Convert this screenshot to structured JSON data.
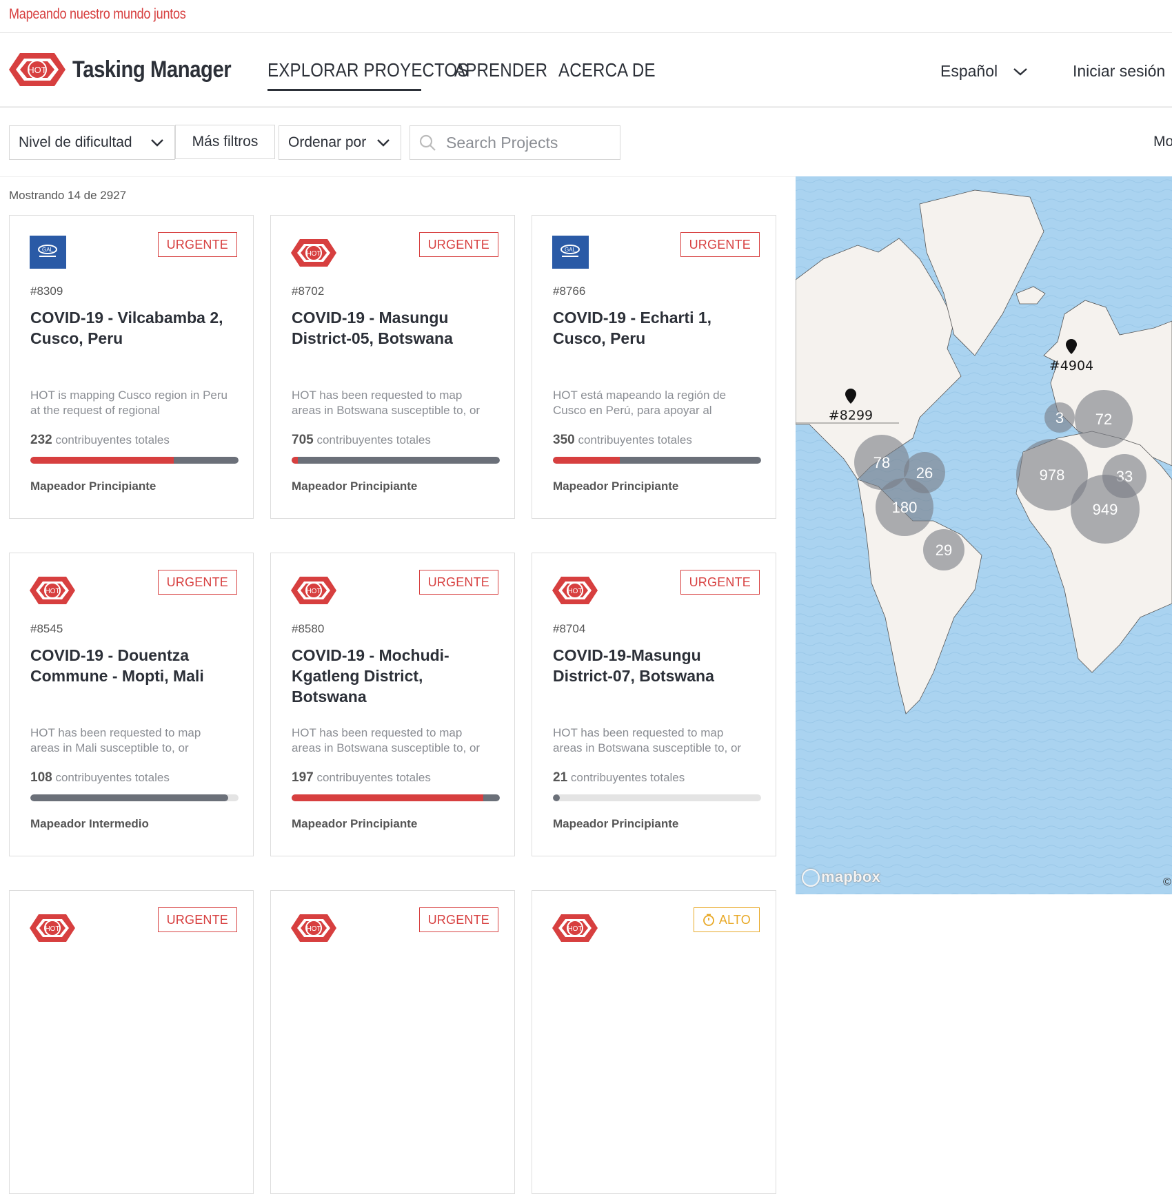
{
  "banner": {
    "text": "Mapeando nuestro mundo juntos"
  },
  "header": {
    "brand": "Tasking Manager",
    "nav": [
      {
        "label": "EXPLORAR PROYECTOS",
        "active": true
      },
      {
        "label": "APRENDER",
        "active": false
      },
      {
        "label": "ACERCA DE",
        "active": false
      }
    ],
    "language": "Español",
    "login": "Iniciar sesión"
  },
  "filters": {
    "difficulty": "Nivel de dificultad",
    "more": "Más filtros",
    "sort": "Ordenar por",
    "search_placeholder": "Search Projects",
    "more_cut": "Mo"
  },
  "results": {
    "showing": "Mostrando 14 de 2927",
    "contrib_label": "contribuyentes totales",
    "cards": [
      {
        "org": "gal",
        "badge": "URGENTE",
        "id": "#8309",
        "title": "COVID-19 - Vilcabamba 2, Cusco, Peru",
        "desc": "HOT is mapping Cusco region in Peru at the request of regional",
        "contributors": "232",
        "mapped_pct": 0.69,
        "validated_pct": 1.0,
        "level": "Mapeador Principiante"
      },
      {
        "org": "hot",
        "badge": "URGENTE",
        "id": "#8702",
        "title": "COVID-19 - Masungu District-05, Botswana",
        "desc": "HOT has been requested to map areas in Botswana susceptible to, or",
        "contributors": "705",
        "mapped_pct": 0.03,
        "validated_pct": 1.0,
        "level": "Mapeador Principiante"
      },
      {
        "org": "gal",
        "badge": "URGENTE",
        "id": "#8766",
        "title": "COVID-19 - Echarti 1, Cusco, Peru",
        "desc": "HOT está mapeando la región de Cusco en Perú, para apoyar al",
        "contributors": "350",
        "mapped_pct": 0.32,
        "validated_pct": 1.0,
        "level": "Mapeador Principiante"
      },
      {
        "org": "hot",
        "badge": "URGENTE",
        "id": "#8545",
        "title": "COVID-19 - Douentza Commune - Mopti, Mali",
        "desc": "HOT has been requested to map areas in Mali susceptible to, or",
        "contributors": "108",
        "mapped_pct": 0.0,
        "validated_pct": 0.95,
        "level": "Mapeador Intermedio"
      },
      {
        "org": "hot",
        "badge": "URGENTE",
        "id": "#8580",
        "title": "COVID-19 - Mochudi-Kgatleng District, Botswana",
        "desc": "HOT has been requested to map areas in Botswana susceptible to, or",
        "contributors": "197",
        "mapped_pct": 0.92,
        "validated_pct": 1.0,
        "level": "Mapeador Principiante"
      },
      {
        "org": "hot",
        "badge": "URGENTE",
        "id": "#8704",
        "title": "COVID-19-Masungu District-07, Botswana",
        "desc": "HOT has been requested to map areas in Botswana susceptible to, or",
        "contributors": "21",
        "mapped_pct": 0.0,
        "validated_pct": 0.03,
        "level": "Mapeador Principiante"
      },
      {
        "org": "hot",
        "badge": "URGENTE"
      },
      {
        "org": "hot",
        "badge": "URGENTE"
      },
      {
        "org": "hot",
        "badge": "ALTO"
      }
    ]
  },
  "map": {
    "clusters": [
      {
        "label": "78"
      },
      {
        "label": "26"
      },
      {
        "label": "180"
      },
      {
        "label": "29"
      },
      {
        "label": "3"
      },
      {
        "label": "72"
      },
      {
        "label": "978"
      },
      {
        "label": "33"
      },
      {
        "label": "949"
      }
    ],
    "pins": [
      {
        "label": "#8299"
      },
      {
        "label": "#4904"
      }
    ],
    "attribution": "mapbox",
    "copyright": "©"
  },
  "colors": {
    "accent": "#d73f3f",
    "alto": "#e8a825",
    "water": "#aad3f0",
    "land": "#f5f2ee",
    "bar": "#6b7079"
  }
}
